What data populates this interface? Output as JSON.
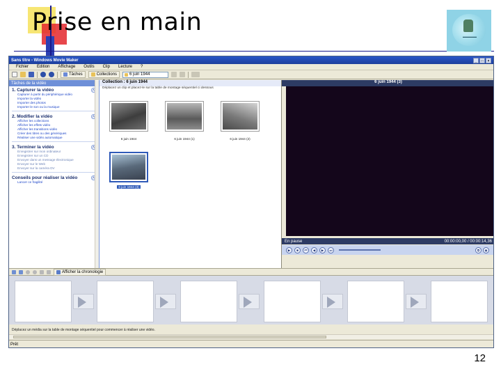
{
  "slide": {
    "title": "Prise en main",
    "page_number": "12"
  },
  "window": {
    "title": "Sans titre - Windows Movie Maker",
    "controls": [
      "_",
      "□",
      "×"
    ]
  },
  "menu": [
    "Fichier",
    "Edition",
    "Affichage",
    "Outils",
    "Clip",
    "Lecture",
    "?"
  ],
  "toolbar": {
    "tasks_button": "Tâches",
    "collections_button": "Collections",
    "collection_value": "6 juin 1944"
  },
  "tasks": {
    "header": "Tâches de la vidéo",
    "sections": [
      {
        "num": "1.",
        "title": "Capturer la vidéo",
        "links": [
          "Capturer à partir du périphérique vidéo",
          "Importer la vidéo",
          "Importer des photos",
          "Importer le son ou la musique"
        ]
      },
      {
        "num": "2.",
        "title": "Modifier la vidéo",
        "links": [
          "Afficher les collections",
          "Afficher les effets vidéo",
          "Afficher les transitions vidéo",
          "Créer des titres ou des génériques",
          "Réaliser une vidéo automatique"
        ]
      },
      {
        "num": "3.",
        "title": "Terminer la vidéo",
        "links": [
          "Enregistrer sur mon ordinateur",
          "Enregistrer sur un CD",
          "Envoyer dans un message électronique",
          "Envoyer sur le Web",
          "Envoyer sur la caméra DV"
        ]
      },
      {
        "num": "",
        "title": "Conseils pour réaliser la vidéo",
        "links": [
          "Lancer ce fragilité"
        ]
      }
    ]
  },
  "collection": {
    "header": "Collection : 6 juin 1944",
    "subtitle": "Déplacez un clip et placez-le sur la table de montage séquentiel ci dessous",
    "clips": [
      {
        "label": "6 juin 1944",
        "selected": false
      },
      {
        "label": "6 juin 1944 (1)",
        "selected": false
      },
      {
        "label": "6 juin 1944 (2)",
        "selected": false
      },
      {
        "label": "6 juin 1944 (3)",
        "selected": true
      }
    ]
  },
  "monitor": {
    "title": "6 juin 1944 (3)",
    "status": "En pause",
    "time": "00:00:00,00 / 00:00:14,36"
  },
  "storyboard": {
    "toggle_label": "Afficher la chronologie",
    "hint": "Déplacez un média sur la table de montage séquentiel pour commencer à réaliser une vidéo."
  },
  "statusbar": {
    "text": "Prêt"
  }
}
